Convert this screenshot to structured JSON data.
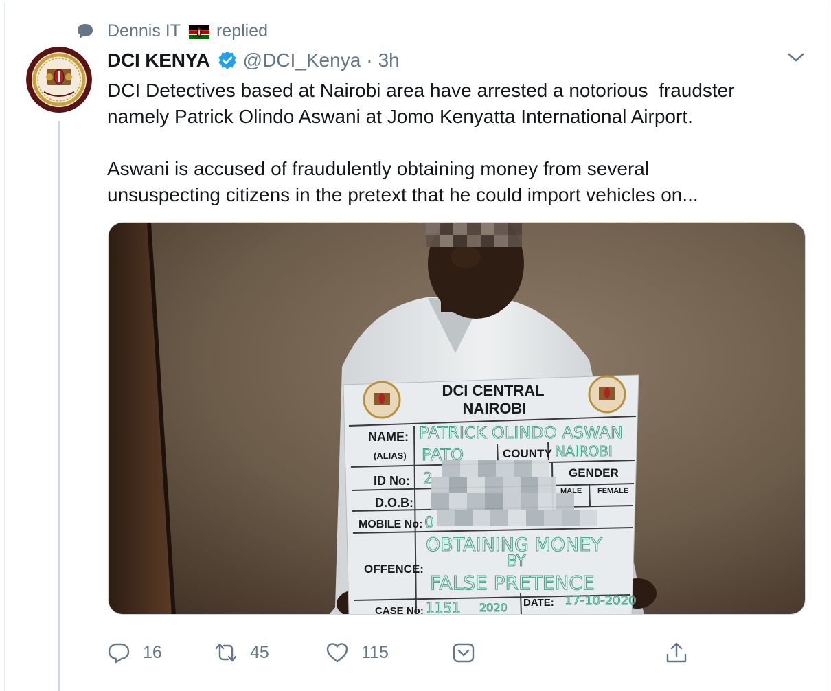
{
  "social_context": {
    "user": "Dennis IT",
    "action": "replied",
    "icons": [
      "reply-bubble-icon",
      "kenya-flag-icon"
    ]
  },
  "author": {
    "display_name": "DCI KENYA",
    "handle": "@DCI_Kenya",
    "separator": "·",
    "time": "3h",
    "verified": true,
    "icons": [
      "verified-badge-icon",
      "chevron-down-icon"
    ]
  },
  "tweet": {
    "paragraph_1": "DCI Detectives based at Nairobi area have arrested a notorious  fraudster\nnamely Patrick Olindo Aswani at Jomo Kenyatta International Airport.",
    "paragraph_2": "Aswani is accused of fraudulently obtaining money from several\nunsuspecting citizens in the pretext that he could import vehicles on..."
  },
  "photo": {
    "board_title_1": "DCI CENTRAL",
    "board_title_2": "NAIROBI",
    "labels": {
      "name": "NAME:",
      "alias": "(ALIAS)",
      "id_no": "ID No:",
      "dob": "D.O.B:",
      "mobile": "MOBILE No:",
      "offence": "OFFENCE:",
      "case_no": "CASE No:",
      "county": "COUNTY",
      "gender": "GENDER",
      "male": "MALE",
      "female": "FEMALE",
      "date": "DATE:"
    },
    "handwritten": {
      "name": "PATRICK OLINDO ASWAN",
      "alias": "PATO",
      "county": "NAIROBI",
      "id": "2",
      "mobile": "0",
      "offence_1": "OBTAINING MONEY",
      "offence_2": "BY",
      "offence_3": "FALSE PRETENCE",
      "case": "1151",
      "case_year": "2020",
      "date": "17-10-2020"
    }
  },
  "actions": {
    "replies": "16",
    "retweets": "45",
    "likes": "115",
    "icons": [
      "reply-icon",
      "retweet-icon",
      "like-heart-icon",
      "save-icon",
      "share-icon"
    ]
  }
}
